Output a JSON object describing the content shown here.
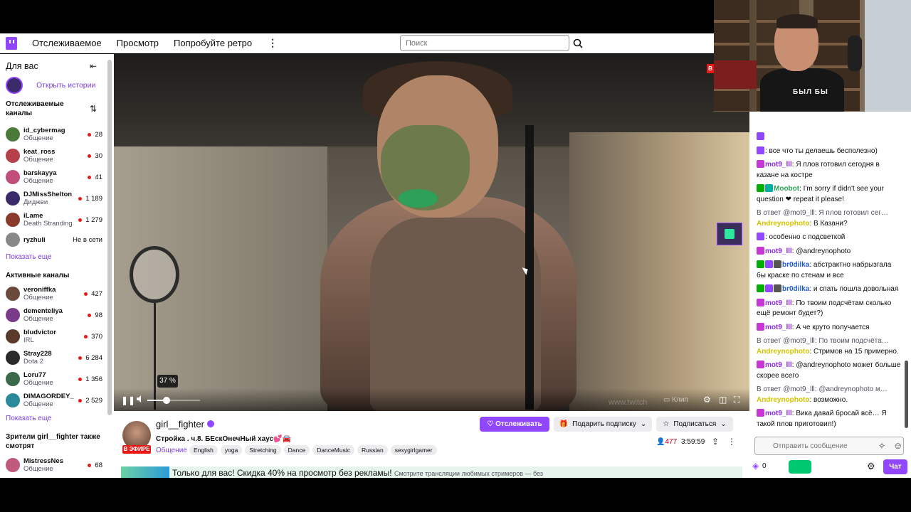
{
  "topbar": {
    "nav": [
      "Отслеживаемое",
      "Просмотр",
      "Попробуйте ретро"
    ],
    "more_icon": "more-vertical-icon",
    "search_placeholder": "Поиск",
    "brand_color": "#9146ff"
  },
  "sidebar": {
    "header": "Для вас",
    "stories_label": "Открыть истории",
    "followed_title": "Отслеживаемые каналы",
    "followed": [
      {
        "name": "id_cybermag",
        "category": "Общение",
        "viewers": "28",
        "color": "#4a7a3a"
      },
      {
        "name": "keat_ross",
        "category": "Общение",
        "viewers": "30",
        "color": "#b5404a"
      },
      {
        "name": "barskayya",
        "category": "Общение",
        "viewers": "41",
        "color": "#c0507a"
      },
      {
        "name": "DJMissShelton",
        "category": "Диджеи",
        "viewers": "1 189",
        "color": "#3a2a6a"
      },
      {
        "name": "iLame",
        "category": "Death Stranding",
        "viewers": "1 279",
        "color": "#8a3a2a"
      },
      {
        "name": "ryzhuli",
        "category": "",
        "viewers": "",
        "offline": "Не в сети",
        "color": "#888"
      }
    ],
    "show_more_1": "Показать еще",
    "active_title": "Активные каналы",
    "active": [
      {
        "name": "veroniffka",
        "category": "Общение",
        "viewers": "427",
        "color": "#6a4a3a"
      },
      {
        "name": "dementeliya",
        "category": "Общение",
        "viewers": "98",
        "color": "#7a3a8a"
      },
      {
        "name": "bludvictor",
        "category": "IRL",
        "viewers": "370",
        "color": "#5a3a2a"
      },
      {
        "name": "Stray228",
        "category": "Dota 2",
        "viewers": "6 284",
        "color": "#2a2a2a"
      },
      {
        "name": "Loru77",
        "category": "Общение",
        "viewers": "1 356",
        "color": "#3a6a4a"
      },
      {
        "name": "DIMAGORDEY_",
        "category": "Общение",
        "viewers": "2 529",
        "color": "#2a8a9a"
      }
    ],
    "show_more_2": "Показать еще",
    "viewers_also_title": "Зрители girl__fighter также смотрят",
    "also": [
      {
        "name": "MistressNes",
        "category": "Общение",
        "viewers": "68",
        "color": "#c05a7a"
      }
    ]
  },
  "player": {
    "volume_percent": 37,
    "volume_label": "37 %",
    "clip_label": "Клип",
    "watermark": "www.twitch"
  },
  "channel": {
    "name": "girl__fighter",
    "title": "Стройка . ч.8. БЕскОнечНый хаус💕🚘",
    "live_badge": "В ЭФИРЕ",
    "category": "Общение",
    "tags": [
      "English",
      "yoga",
      "Stretching",
      "Dance",
      "DanceMusic",
      "Russian",
      "sexygirlgamer"
    ],
    "follow_label": "Отслеживать",
    "gift_label": "Подарить подписку",
    "subscribe_label": "Подписаться",
    "viewers": "477",
    "uptime": "3:59:59",
    "promo_text": "Только для вас! Скидка 40% на просмотр без рекламы!",
    "promo_sub": "Смотрите трансляции любимых стримеров — без"
  },
  "chat": {
    "messages": [
      {
        "user": "",
        "text": "",
        "badges": [
          "#9146ff"
        ],
        "ucolor": "#d4c300"
      },
      {
        "user": "",
        "text": ": все что ты делаешь бесполезно)",
        "badges": [
          "#9146ff"
        ],
        "ucolor": "#d4c300"
      },
      {
        "user": "mot9_lll",
        "text": ": Я плов готовил сегодня в казане на костре",
        "badges": [
          "#c737d7"
        ],
        "ucolor": "#8a2be2"
      },
      {
        "user": "Moobot",
        "text": ": I'm sorry if didn't see your question ❤ repeat it please!",
        "badges": [
          "#00ad03",
          "#00ad9f"
        ],
        "ucolor": "#2fa05a"
      },
      {
        "reply": "В ответ @mot9_lll: Я плов готовил сег…",
        "user": "Andreynophoto",
        "text": ": В Казани?",
        "badges": [],
        "ucolor": "#d4c300"
      },
      {
        "user": "",
        "text": ": особенно с подсветкой",
        "badges": [
          "#9146ff"
        ],
        "ucolor": "#d4c300"
      },
      {
        "user": "mot9_lll",
        "text": ": @andreynophoto",
        "badges": [
          "#c737d7"
        ],
        "ucolor": "#8a2be2"
      },
      {
        "user": "br0dilka",
        "text": ": абстрактно набрызгала бы краске по стенам и все",
        "badges": [
          "#00ad03",
          "#9146ff",
          "#555"
        ],
        "ucolor": "#1e5bd8"
      },
      {
        "user": "br0dilka",
        "text": ": и спать пошла довольная",
        "badges": [
          "#00ad03",
          "#9146ff",
          "#555"
        ],
        "ucolor": "#1e5bd8"
      },
      {
        "user": "mot9_lll",
        "text": ": По твоим подсчётам сколько ещё ремонт будет?)",
        "badges": [
          "#c737d7"
        ],
        "ucolor": "#8a2be2"
      },
      {
        "user": "mot9_lll",
        "text": ": А че круто получается",
        "badges": [
          "#c737d7"
        ],
        "ucolor": "#8a2be2"
      },
      {
        "reply": "В ответ @mot9_lll: По твоим подсчёта…",
        "user": "Andreynophoto",
        "text": ": Стримов на 15 примерно.",
        "badges": [],
        "ucolor": "#d4c300"
      },
      {
        "user": "mot9_lll",
        "text": ": @andreynophoto может больше скорее всего",
        "badges": [
          "#c737d7"
        ],
        "ucolor": "#8a2be2"
      },
      {
        "reply": "В ответ @mot9_lll: @andreynophoto м…",
        "user": "Andreynophoto",
        "text": ": возможно.",
        "badges": [],
        "ucolor": "#d4c300"
      },
      {
        "user": "mot9_lll",
        "text": ": Вика давай бросай всё… Я такой плов приготовил!)",
        "badges": [
          "#c737d7"
        ],
        "ucolor": "#8a2be2"
      }
    ],
    "input_placeholder": "Отправить сообщение",
    "points": "0",
    "chat_button": "Чат"
  },
  "webcam": {
    "shirt_text": "БЫЛ БЫ"
  }
}
